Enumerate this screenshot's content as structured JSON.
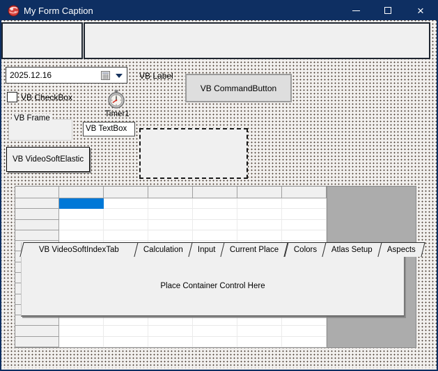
{
  "window": {
    "title": "My Form Caption",
    "titlebar_color": "#0e2f62",
    "close_glyph": "×"
  },
  "controls": {
    "date_picker": {
      "value": "2025.12.16"
    },
    "vb_label": "VB Label",
    "command_button": "VB CommandButton",
    "checkbox": "VB CheckBox",
    "timer": "Timer1",
    "frame": "VB Frame",
    "textbox": "VB TextBox",
    "elastic": "VB VideoSoftElastic"
  },
  "grid": {
    "columns": 6,
    "rows": 14,
    "selected_cell": {
      "row": 0,
      "col": 0
    },
    "selection_color": "#0078d7"
  },
  "tab_control": {
    "tabs": [
      {
        "label": "VB VideoSoftIndexTab",
        "active": true
      },
      {
        "label": "Calculation",
        "active": false
      },
      {
        "label": "Input",
        "active": false
      },
      {
        "label": "Current Place",
        "active": false
      },
      {
        "label": "Colors",
        "active": false
      },
      {
        "label": "Atlas Setup",
        "active": false
      },
      {
        "label": "Aspects",
        "active": false
      }
    ],
    "body_text": "Place Container Control Here"
  }
}
